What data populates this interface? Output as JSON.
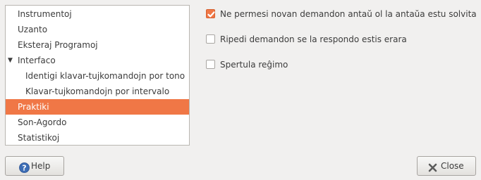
{
  "tree": {
    "items": [
      {
        "label": "Instrumentoj"
      },
      {
        "label": "Uzanto"
      },
      {
        "label": "Eksteraj Programoj"
      },
      {
        "label": "Interfaco",
        "expander": "▼"
      },
      {
        "label": "Identigi klavar-tujkomandojn por tono"
      },
      {
        "label": "Klavar-tujkomandojn por intervalo"
      },
      {
        "label": "Praktiki"
      },
      {
        "label": "Son-Agordo"
      },
      {
        "label": "Statistikoj"
      }
    ]
  },
  "options": [
    {
      "label": "Ne permesi novan demandon antaŭ ol la antaŭa estu solvita",
      "checked": true
    },
    {
      "label": "Ripedi demandon se la respondo estis erara",
      "checked": false
    },
    {
      "label": "Spertula reĝimo",
      "checked": false
    }
  ],
  "buttons": {
    "help_label": "Help",
    "close_label": "Close"
  },
  "colors": {
    "accent": "#f07746",
    "background": "#f1f0ef"
  },
  "icons": {
    "help": "help-icon",
    "close": "close-icon"
  }
}
